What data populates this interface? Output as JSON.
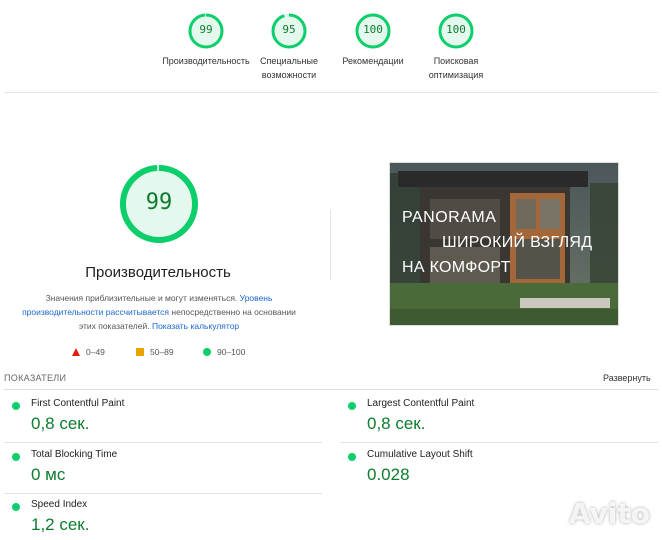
{
  "top_scores": [
    {
      "value": "99",
      "label": "Производительность",
      "score": 99
    },
    {
      "value": "95",
      "label": "Специальные возможности",
      "score": 95
    },
    {
      "value": "100",
      "label": "Рекомендации",
      "score": 100
    },
    {
      "value": "100",
      "label": "Поисковая оптимизация",
      "score": 100
    }
  ],
  "performance": {
    "score_text": "99",
    "score": 99,
    "title": "Производительность",
    "desc_part1": "Значения приблизительные и могут изменяться.",
    "desc_link1": "Уровень производительности рассчитывается",
    "desc_part2": "непосредственно на основании этих показателей.",
    "desc_link2": "Показать калькулятор"
  },
  "legend": {
    "fail": "0–49",
    "average": "50–89",
    "pass": "90–100"
  },
  "preview": {
    "line1": "PANORAMA",
    "line2": "ШИРОКИЙ ВЗГЛЯД",
    "line3": "НА КОМФОРТ"
  },
  "metrics_section": {
    "header": "ПОКАЗАТЕЛИ",
    "expand": "Развернуть"
  },
  "metrics": [
    {
      "label": "First Contentful Paint",
      "value": "0,8 сек."
    },
    {
      "label": "Largest Contentful Paint",
      "value": "0,8 сек."
    },
    {
      "label": "Total Blocking Time",
      "value": "0 мс"
    },
    {
      "label": "Cumulative Layout Shift",
      "value": "0.028"
    },
    {
      "label": "Speed Index",
      "value": "1,2 сек."
    }
  ],
  "watermark": "Avito",
  "colors": {
    "pass": "#0cce6b",
    "pass_text": "#0c7c2f",
    "average": "#e6a700",
    "fail": "#e51c0b",
    "link": "#1a66d1"
  }
}
